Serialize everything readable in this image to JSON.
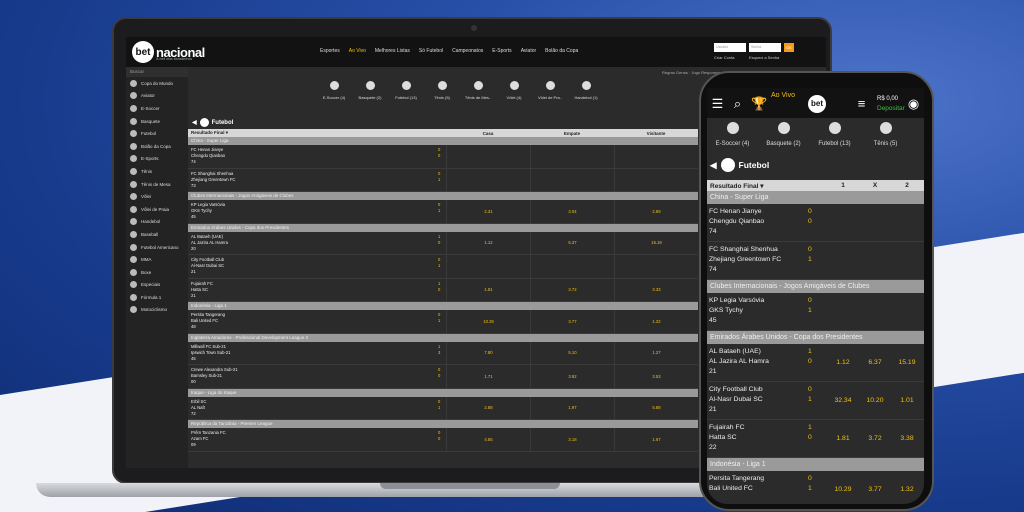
{
  "brand": {
    "name": "betnacional",
    "tagline": "A bet dos brasileiros",
    "logo_mark": "bet"
  },
  "nav": [
    "Esportes",
    "Ao Vivo",
    "Melhores Listas",
    "Só Futebol",
    "Campeonatos",
    "E-Sports",
    "Aviator",
    "Bolão da Copa"
  ],
  "login": {
    "user_placeholder": "Usuário",
    "pass_placeholder": "Senha",
    "ok": "OK",
    "create": "Criar Conta",
    "forgot": "Esqueci a Senha"
  },
  "crumb": "Regras Gerais · Jogo Responsável",
  "sidebar": {
    "search": "Buscar",
    "items": [
      "Copa do Mundo",
      "Aviator",
      "E-Soccer",
      "Basquete",
      "Futebol",
      "Bolão da Copa",
      "E-Sports",
      "Tênis",
      "Tênis de Mesa",
      "Vôlei",
      "Vôlei de Praia",
      "Handebol",
      "Baseball",
      "Futebol Americano",
      "MMA",
      "Boxe",
      "Especiais",
      "Fórmula 1",
      "Motociclismo"
    ]
  },
  "categories": [
    "E-Soccer (4)",
    "Basquete (2)",
    "Futebol (13)",
    "Tênis (5)",
    "Tênis de Mes..",
    "Vôlei (4)",
    "Vôlei de Pra..",
    "Handebol (1)"
  ],
  "sport_title": "Futebol",
  "table": {
    "cols": [
      "Resultado Final ▾",
      "Casa",
      "Empate",
      "Visitante"
    ],
    "leagues": [
      {
        "name": "China - Super Liga",
        "events": [
          {
            "home": "FC Henan Jianye",
            "away": "Chengdu Qianbao",
            "min": "74",
            "sh": "0",
            "sa": "0",
            "o": [
              "",
              "",
              ""
            ]
          },
          {
            "home": "FC Shanghai Shenhua",
            "away": "Zhejiang Greentown FC",
            "min": "73",
            "sh": "0",
            "sa": "1",
            "o": [
              "",
              "",
              ""
            ]
          }
        ]
      },
      {
        "name": "Clubes Internacionais - Jogos Amigáveis de Clubes",
        "events": [
          {
            "home": "KP Legia Varsóvia",
            "away": "GKS Tychy",
            "min": "45",
            "sh": "0",
            "sa": "1",
            "o": [
              "2.31",
              "3.04",
              "2.89"
            ]
          }
        ]
      },
      {
        "name": "Emirados Árabes Unidos - Copa dos Presidentes",
        "events": [
          {
            "home": "AL Bataeh (UAE)",
            "away": "AL Jazira AL Hamra",
            "min": "20",
            "sh": "1",
            "sa": "0",
            "o": [
              "1.12",
              "6.37",
              "15.19"
            ]
          },
          {
            "home": "City Football Club",
            "away": "Al-Nasr Dubai SC",
            "min": "21",
            "sh": "0",
            "sa": "1",
            "o": [
              "",
              "",
              ""
            ]
          },
          {
            "home": "Fujairah FC",
            "away": "Hatta SC",
            "min": "21",
            "sh": "1",
            "sa": "0",
            "o": [
              "1.81",
              "3.72",
              "3.33"
            ]
          }
        ]
      },
      {
        "name": "Indonésia - Liga 1",
        "events": [
          {
            "home": "Persita Tangerang",
            "away": "Bali United FC",
            "min": "48",
            "sh": "0",
            "sa": "1",
            "o": [
              "10.29",
              "3.77",
              "1.32"
            ]
          }
        ]
      },
      {
        "name": "Inglaterra Amadores - Professional Development League 2",
        "events": [
          {
            "home": "Millwall FC Sub-21",
            "away": "Ipswich Town Sub-21",
            "min": "45",
            "sh": "1",
            "sa": "3",
            "o": [
              "7.80",
              "5.10",
              "1.27"
            ]
          },
          {
            "home": "Crewe Alexandra Sub-21",
            "away": "Barnsley Sub-21",
            "min": "00",
            "sh": "0",
            "sa": "0",
            "o": [
              "1.71",
              "3.92",
              "3.53"
            ]
          }
        ]
      },
      {
        "name": "Iraque - Liga do Iraque",
        "events": [
          {
            "home": "Erbil SC",
            "away": "AL Naft",
            "min": "72",
            "sh": "0",
            "sa": "1",
            "o": [
              "2.88",
              "1.97",
              "5.88"
            ]
          }
        ]
      },
      {
        "name": "República da Tanzânia - Premier League",
        "events": [
          {
            "home": "Prêm Tanzania FC",
            "away": "Azam FC",
            "min": "09",
            "sh": "0",
            "sa": "0",
            "o": [
              "4.85",
              "3.18",
              "1.67"
            ]
          }
        ]
      }
    ]
  },
  "phone": {
    "ao_vivo": "Ao Vivo",
    "logo": "bet",
    "balance": "R$ 0,00",
    "deposit": "Depositar",
    "categories": [
      "E-Soccer (4)",
      "Basquete (2)",
      "Futebol (13)",
      "Tênis (5)"
    ],
    "sport_title": "Futebol",
    "cols": [
      "Resultado Final ▾",
      "1",
      "X",
      "2"
    ],
    "leagues": [
      {
        "name": "China - Super Liga",
        "events": [
          {
            "home": "FC Henan Jianye",
            "away": "Chengdu Qianbao",
            "min": "74",
            "sh": "0",
            "sa": "0",
            "o": [
              "",
              "",
              ""
            ]
          },
          {
            "home": "FC Shanghai Shenhua",
            "away": "Zhejiang Greentown FC",
            "min": "74",
            "sh": "0",
            "sa": "1",
            "o": [
              "",
              "",
              ""
            ]
          }
        ]
      },
      {
        "name": "Clubes Internacionais - Jogos Amigáveis de Clubes",
        "events": [
          {
            "home": "KP Legia Varsóvia",
            "away": "GKS Tychy",
            "min": "45",
            "sh": "0",
            "sa": "1",
            "o": [
              "",
              "",
              ""
            ]
          }
        ]
      },
      {
        "name": "Emirados Árabes Unidos - Copa dos Presidentes",
        "events": [
          {
            "home": "AL Bataeh (UAE)",
            "away": "AL Jazira AL Hamra",
            "min": "21",
            "sh": "1",
            "sa": "0",
            "o": [
              "1.12",
              "6.37",
              "15.19"
            ]
          },
          {
            "home": "City Football Club",
            "away": "Al-Nasr Dubai SC",
            "min": "21",
            "sh": "0",
            "sa": "1",
            "o": [
              "32.34",
              "10.20",
              "1.01"
            ]
          },
          {
            "home": "Fujairah FC",
            "away": "Hatta SC",
            "min": "22",
            "sh": "1",
            "sa": "0",
            "o": [
              "1.81",
              "3.72",
              "3.38"
            ]
          }
        ]
      },
      {
        "name": "Indonésia - Liga 1",
        "events": [
          {
            "home": "Persita Tangerang",
            "away": "Bali United FC",
            "min": "",
            "sh": "0",
            "sa": "1",
            "o": [
              "10.29",
              "3.77",
              "1.32"
            ]
          }
        ]
      }
    ]
  }
}
